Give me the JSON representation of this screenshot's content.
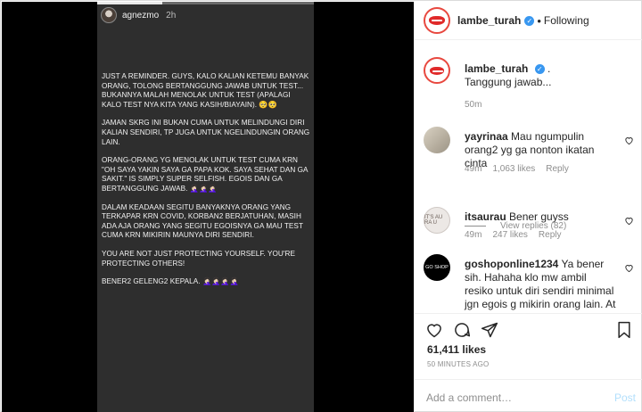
{
  "story": {
    "username": "agnezmo",
    "time": "2h",
    "paragraphs": [
      "JUST A REMINDER. GUYS, KALO KALIAN KETEMU BANYAK ORANG, TOLONG BERTANGGUNG JAWAB UNTUK TEST... BUKANNYA MALAH MENOLAK UNTUK TEST (APALAGI KALO TEST NYA KITA YANG KASIH/BIAYAIN). 🥺🥺",
      "JAMAN SKRG INI BUKAN CUMA UNTUK MELINDUNGI DIRI KALIAN SENDIRI, TP JUGA UNTUK NGELINDUNGIN ORANG LAIN.",
      "ORANG-ORANG YG MENOLAK UNTUK TEST CUMA KRN \"OH SAYA YAKIN SAYA GA PAPA KOK. SAYA SEHAT DAN GA SAKIT.\" IS SIMPLY SUPER SELFISH. EGOIS DAN GA BERTANGGUNG JAWAB. 🤦🏻‍♀️🤦🏻‍♀️🤦🏻‍♀️",
      "DALAM KEADAAN SEGITU BANYAKNYA ORANG YANG TERKAPAR KRN COVID, KORBAN2 BERJATUHAN, MASIH ADA AJA ORANG YANG SEGITU EGOISNYA GA MAU TEST CUMA KRN MIKIRIN MAUNYA DIRI SENDIRI.",
      "YOU ARE NOT JUST PROTECTING YOURSELF. YOU'RE PROTECTING OTHERS!",
      "BENER2 GELENG2 KEPALA. 🤦🏻‍♀️🤦🏻‍♀️🤦🏻‍♀️🤦🏻‍♀️"
    ]
  },
  "header": {
    "username": "lambe_turah",
    "separator": "•",
    "follow_status": "Following"
  },
  "caption": {
    "username": "lambe_turah",
    "period": ".",
    "text": "Tanggung jawab...",
    "time": "50m"
  },
  "comments": [
    {
      "username": "yayrinaa",
      "text": "Mau ngumpulin orang2 yg ga nonton ikatan cinta",
      "time": "49m",
      "likes": "1,063 likes",
      "reply": "Reply"
    },
    {
      "username": "itsaurau",
      "text": "Bener guyss",
      "time": "49m",
      "likes": "247 likes",
      "reply": "Reply",
      "avatar_text": "IT'S AU RA U"
    },
    {
      "username": "goshoponline1234",
      "text": "Ya bener sih. Hahaha klo mw ambil resiko untuk diri sendiri minimal jgn egois g mikirin orang lain. At",
      "avatar_text": "GO SHOP"
    }
  ],
  "view_replies": "View replies (82)",
  "post": {
    "likes": "61,411 likes",
    "time_ago": "50 MINUTES AGO"
  },
  "add_comment": {
    "placeholder": "Add a comment…",
    "post_label": "Post"
  },
  "colors": {
    "verified": "#3897f0",
    "brand_ring": "#e8483f",
    "post_disabled": "#b2dffc"
  }
}
